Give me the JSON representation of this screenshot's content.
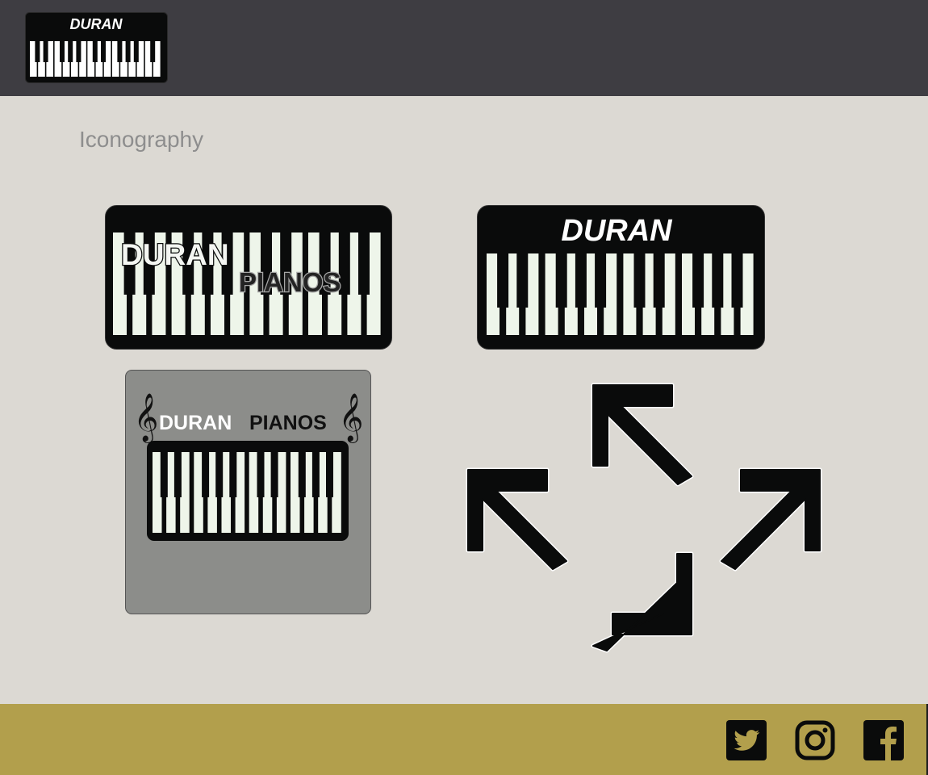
{
  "header": {
    "logo": {
      "text": "DURAN"
    }
  },
  "main": {
    "section_title": "Iconography",
    "icons": {
      "keyboard_logo": {
        "line1": "DURAN",
        "line2": "PIANOS"
      },
      "duran_logo": {
        "text": "DURAN"
      },
      "pianos_square_logo": {
        "word1": "DURAN",
        "word2": "PIANOS",
        "symbol": "𝄞"
      },
      "expand_arrows": {
        "name": "expand-arrows-icon"
      }
    }
  },
  "footer": {
    "social_links": [
      {
        "name": "twitter-icon"
      },
      {
        "name": "instagram-icon"
      },
      {
        "name": "facebook-icon"
      }
    ]
  },
  "colors": {
    "header_bg": "#3e3d42",
    "main_bg": "#dcd9d3",
    "footer_bg": "#b29f4c",
    "logo_black": "#0a0b0b",
    "key_white": "#eef5ea",
    "square_bg": "#8c8d8a",
    "title_gray": "#8e8e8e"
  }
}
